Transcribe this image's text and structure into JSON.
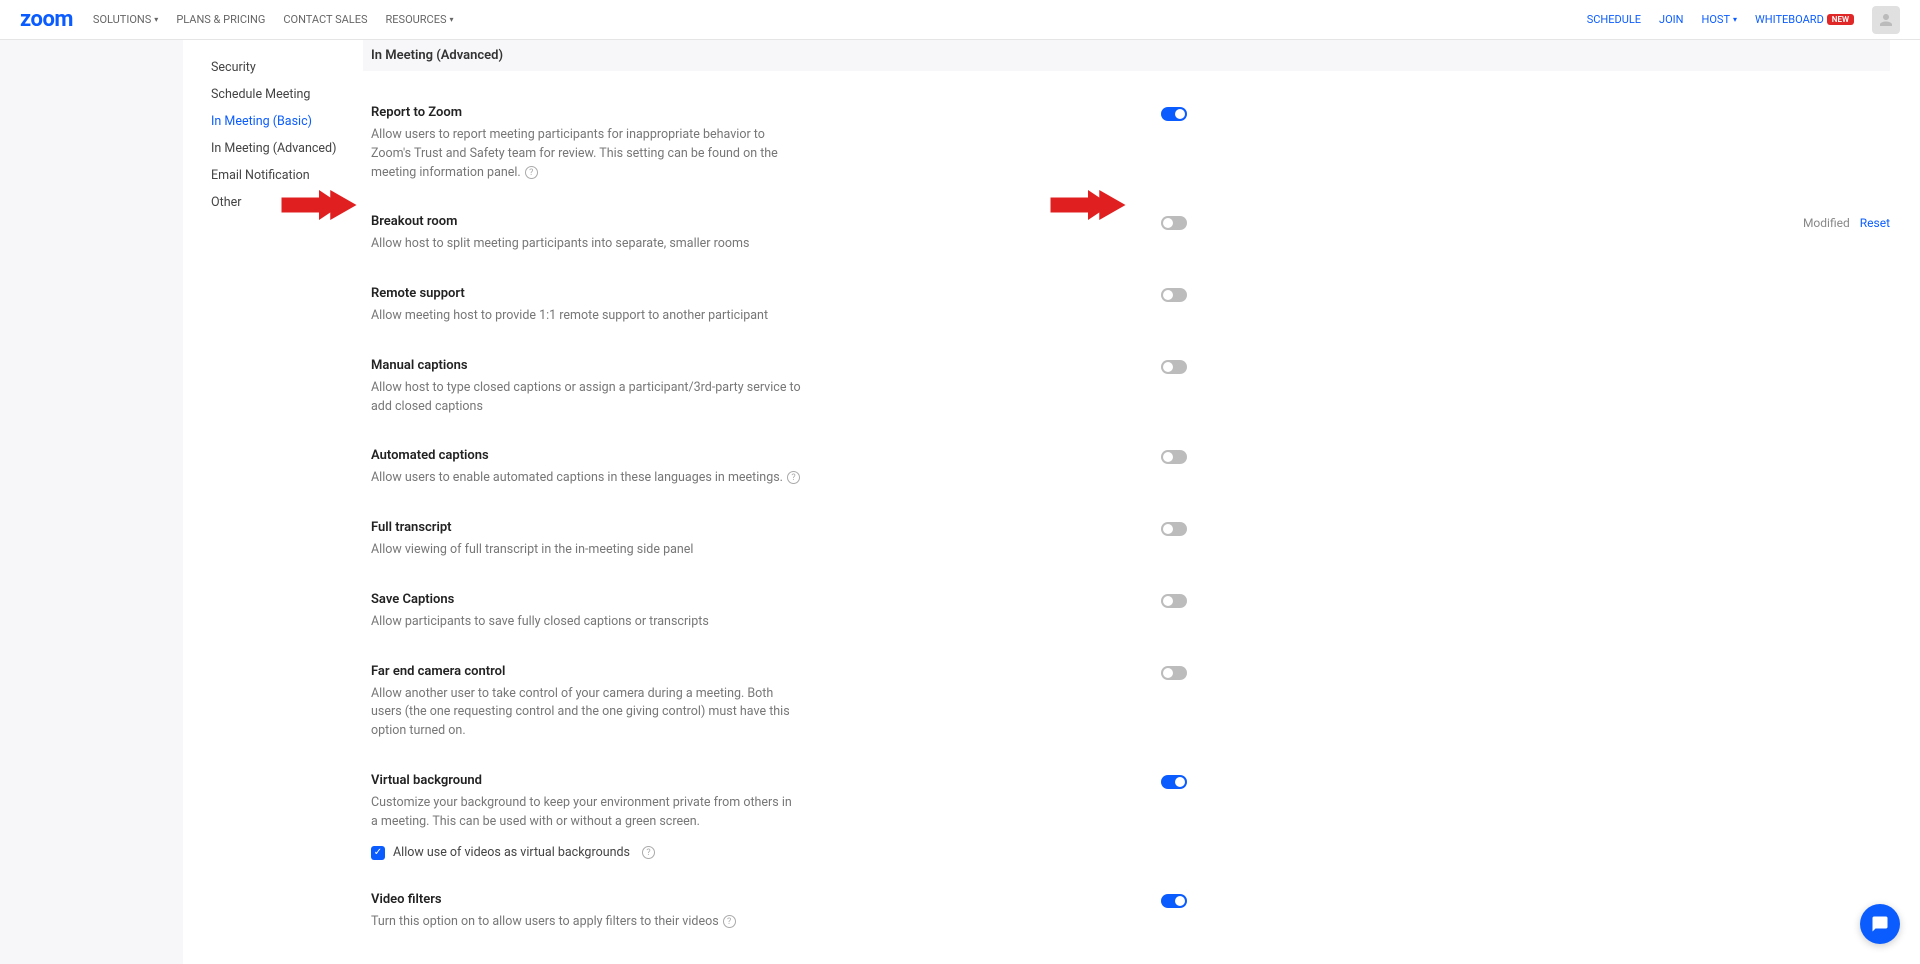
{
  "header": {
    "logo": "zoom",
    "nav_left": [
      {
        "label": "SOLUTIONS",
        "caret": true
      },
      {
        "label": "PLANS & PRICING",
        "caret": false
      },
      {
        "label": "CONTACT SALES",
        "caret": false
      },
      {
        "label": "RESOURCES",
        "caret": true
      }
    ],
    "nav_right": {
      "schedule": "SCHEDULE",
      "join": "JOIN",
      "host": "HOST",
      "whiteboard": "WHITEBOARD",
      "new_badge": "NEW"
    }
  },
  "subnav": [
    {
      "label": "Security",
      "active": false
    },
    {
      "label": "Schedule Meeting",
      "active": false
    },
    {
      "label": "In Meeting (Basic)",
      "active": true
    },
    {
      "label": "In Meeting (Advanced)",
      "active": false
    },
    {
      "label": "Email Notification",
      "active": false
    },
    {
      "label": "Other",
      "active": false
    }
  ],
  "section_header": "In Meeting (Advanced)",
  "settings": [
    {
      "key": "report",
      "title": "Report to Zoom",
      "desc": "Allow users to report meeting participants for inappropriate behavior to Zoom's Trust and Safety team for review. This setting can be found on the meeting information panel.",
      "info": true,
      "on": true
    },
    {
      "key": "breakout",
      "title": "Breakout room",
      "desc": "Allow host to split meeting participants into separate, smaller rooms",
      "info": false,
      "on": false,
      "modified": "Modified",
      "reset": "Reset"
    },
    {
      "key": "remote-support",
      "title": "Remote support",
      "desc": "Allow meeting host to provide 1:1 remote support to another participant",
      "info": false,
      "on": false
    },
    {
      "key": "manual-captions",
      "title": "Manual captions",
      "desc": "Allow host to type closed captions or assign a participant/3rd-party service to add closed captions",
      "info": false,
      "on": false
    },
    {
      "key": "automated-captions",
      "title": "Automated captions",
      "desc": "Allow users to enable automated captions in these languages in meetings.",
      "info": true,
      "on": false
    },
    {
      "key": "full-transcript",
      "title": "Full transcript",
      "desc": "Allow viewing of full transcript in the in-meeting side panel",
      "info": false,
      "on": false
    },
    {
      "key": "save-captions",
      "title": "Save Captions",
      "desc": "Allow participants to save fully closed captions or transcripts",
      "info": false,
      "on": false
    },
    {
      "key": "far-end",
      "title": "Far end camera control",
      "desc": "Allow another user to take control of your camera during a meeting. Both users (the one requesting control and the one giving control) must have this option turned on.",
      "info": false,
      "on": false
    },
    {
      "key": "virtual-bg",
      "title": "Virtual background",
      "desc": "Customize your background to keep your environment private from others in a meeting. This can be used with or without a green screen.",
      "info": false,
      "on": true,
      "checkbox": {
        "checked": true,
        "label": "Allow use of videos as virtual backgrounds",
        "info": true
      }
    },
    {
      "key": "video-filters",
      "title": "Video filters",
      "desc": "Turn this option on to allow users to apply filters to their videos",
      "info": true,
      "on": true
    }
  ]
}
